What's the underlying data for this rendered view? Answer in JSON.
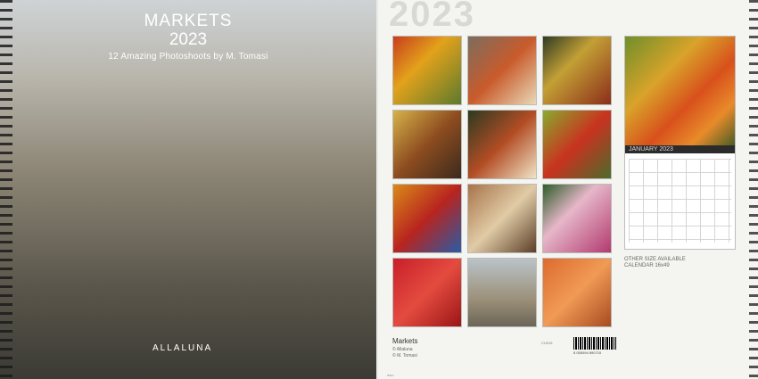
{
  "front": {
    "title": "MARKETS",
    "year": "2023",
    "subtitle": "12 Amazing Photoshoots by M. Tomasi",
    "brand": "ALLALUNA",
    "brand_small": "ALLALUNA"
  },
  "back": {
    "big_year": "2023",
    "calendar_label": "JANUARY 2023",
    "other_size": "OTHER SIZE AVAILABLE",
    "other_size_2": "CALENDAR 16x49",
    "bottom_title": "Markets",
    "credit_1": "© Allaluna",
    "credit_2": "© M. Tomasi",
    "code": "CU015",
    "barcode_number": "8 055094 890715",
    "foot": "ITALY"
  }
}
